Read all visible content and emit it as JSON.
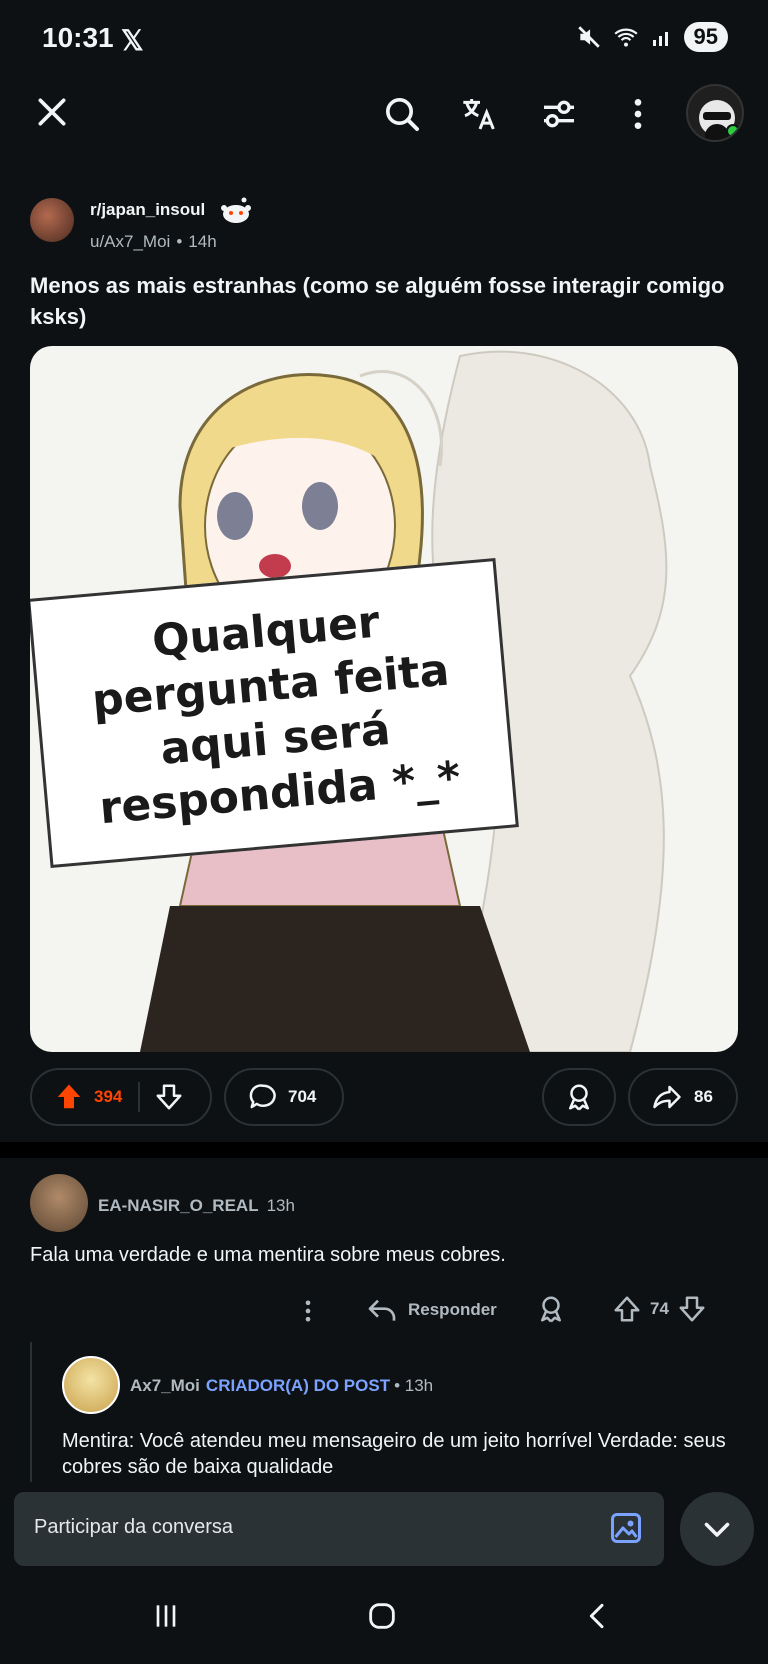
{
  "status_bar": {
    "time": "10:31",
    "x_logo": "𝕏",
    "battery": "95",
    "icons": [
      "mute-icon",
      "wifi-icon",
      "signal-icon"
    ]
  },
  "toolbar": {
    "icons": [
      "close-icon",
      "search-icon",
      "translate-icon",
      "filter-icon",
      "more-icon"
    ]
  },
  "post": {
    "subreddit": "r/japan_insoul",
    "author": "u/Ax7_Moi",
    "separator": "•",
    "age": "14h",
    "title": "Menos as mais estranhas (como se alguém fosse interagir comigo ksks)",
    "image": {
      "sign_lines": [
        "Qualquer",
        "pergunta feita",
        "aqui será",
        "respondida *_*"
      ]
    },
    "upvotes": "394",
    "comments": "704",
    "shares": "86"
  },
  "comments": [
    {
      "user": "EA-NASIR_O_REAL",
      "age": "13h",
      "body": "Fala uma verdade e uma mentira sobre meus cobres.",
      "reply_label": "Responder",
      "score": "74"
    },
    {
      "user": "Ax7_Moi",
      "flair": "CRIADOR(A) DO POST",
      "age": "• 13h",
      "body": "Mentira: Você atendeu meu mensageiro de um jeito horrível Verdade: seus cobres são de baixa qualidade"
    }
  ],
  "composer": {
    "placeholder": "Participar da conversa"
  },
  "colors": {
    "background": "#0e1113",
    "upvote_accent": "#ff4500",
    "op_flair": "#7aa2ff",
    "online": "#2ecc40"
  }
}
